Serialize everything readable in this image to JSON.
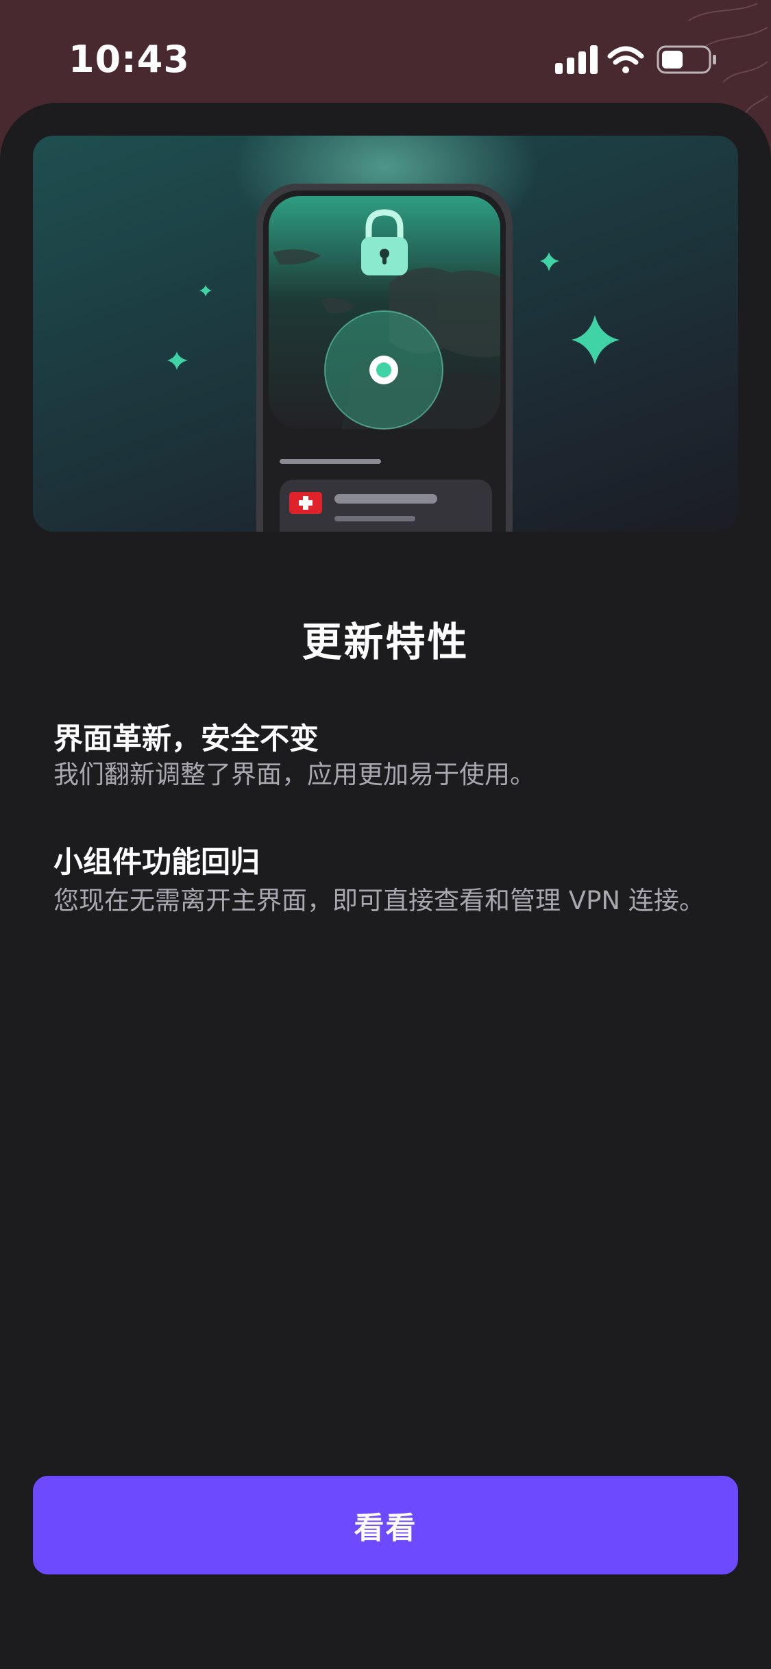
{
  "status_bar": {
    "time": "10:43"
  },
  "heading": "更新特性",
  "features": [
    {
      "title": "界面革新，安全不变",
      "description": "我们翻新调整了界面，应用更加易于使用。"
    },
    {
      "title": "小组件功能回归",
      "description": "您现在无需离开主界面，即可直接查看和管理 VPN 连接。"
    }
  ],
  "cta_label": "看看",
  "colors": {
    "accent": "#6d4afe",
    "teal": "#3fd3a5",
    "sheet_bg": "#1c1c1e",
    "header_bg": "#47292f"
  },
  "icons": [
    "signal-icon",
    "wifi-icon",
    "battery-icon",
    "lock-icon",
    "swiss-flag-icon",
    "location-pin-icon",
    "sparkle-icon"
  ]
}
